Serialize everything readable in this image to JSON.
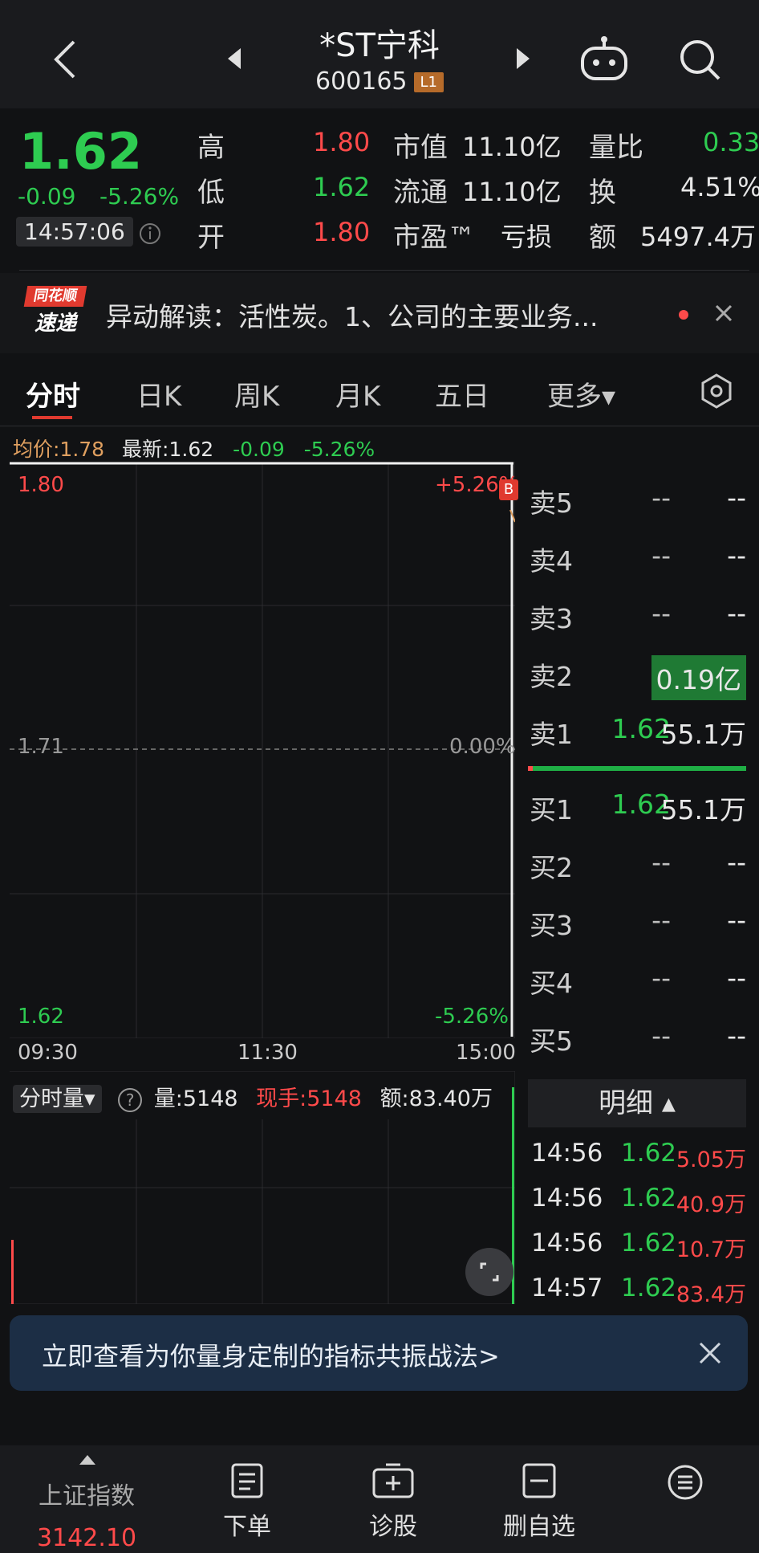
{
  "header": {
    "title": "*ST宁科",
    "code": "600165",
    "level_badge": "L1"
  },
  "quote": {
    "price": "1.62",
    "change": "-0.09",
    "change_pct": "-5.26%",
    "time": "14:57:06",
    "high_label": "高",
    "high": "1.80",
    "low_label": "低",
    "low": "1.62",
    "open_label": "开",
    "open": "1.80",
    "mcap_label": "市值",
    "mcap": "11.10亿",
    "float_label": "流通",
    "float": "11.10亿",
    "pe_label": "市盈™",
    "pe": "亏损",
    "vr_label": "量比",
    "vr": "0.33",
    "turn_label": "换",
    "turn": "4.51%",
    "amt_label": "额",
    "amt": "5497.4万"
  },
  "news": {
    "logo_top": "同花顺",
    "logo_bottom": "速递",
    "text": "异动解读：活性炭。1、公司的主要业务..."
  },
  "tabs": [
    "分时",
    "日K",
    "周K",
    "月K",
    "五日",
    "更多▾"
  ],
  "chart_info": {
    "avg_label": "均价:1.78",
    "latest_label": "最新:1.62",
    "chg": "-0.09",
    "chg_pct": "-5.26%"
  },
  "chart": {
    "y_top": "1.80",
    "y_mid": "1.71",
    "y_bottom": "1.62",
    "pct_top": "+5.26%",
    "pct_mid": "0.00%",
    "pct_bottom": "-5.26%",
    "x_start": "09:30",
    "x_mid": "11:30",
    "x_end": "15:00",
    "marker": "B"
  },
  "chart_data": {
    "type": "line",
    "x": [
      "09:30",
      "11:30",
      "15:00"
    ],
    "series": [
      {
        "values": [
          1.8,
          1.62
        ]
      }
    ],
    "ylim": [
      1.62,
      1.8
    ]
  },
  "volume_bar": {
    "label": "分时量▾",
    "help": "?",
    "vol": "量:5148",
    "hand": "现手:5148",
    "amt": "额:83.40万"
  },
  "order_book": {
    "asks": [
      {
        "label": "卖5",
        "price": "--",
        "vol": "--"
      },
      {
        "label": "卖4",
        "price": "--",
        "vol": "--"
      },
      {
        "label": "卖3",
        "price": "--",
        "vol": "--"
      },
      {
        "label": "卖2",
        "price": "--",
        "vol": "0.19亿"
      },
      {
        "label": "卖1",
        "price": "1.62",
        "vol": "55.1万"
      }
    ],
    "bids": [
      {
        "label": "买1",
        "price": "1.62",
        "vol": "55.1万"
      },
      {
        "label": "买2",
        "price": "--",
        "vol": "--"
      },
      {
        "label": "买3",
        "price": "--",
        "vol": "--"
      },
      {
        "label": "买4",
        "price": "--",
        "vol": "--"
      },
      {
        "label": "买5",
        "price": "--",
        "vol": "--"
      }
    ]
  },
  "details": {
    "title": "明细 ▴",
    "rows": [
      {
        "time": "14:56",
        "price": "1.62",
        "vol": "5.05万"
      },
      {
        "time": "14:56",
        "price": "1.62",
        "vol": "40.9万"
      },
      {
        "time": "14:56",
        "price": "1.62",
        "vol": "10.7万"
      },
      {
        "time": "14:57",
        "price": "1.62",
        "vol": "83.4万"
      }
    ]
  },
  "banner": {
    "text": "立即查看为你量身定制的指标共振战法>"
  },
  "bottom": {
    "index_name": "上证指数",
    "index_value": "3142.10",
    "order": "下单",
    "diagnose": "诊股",
    "remove_fav": "删自选"
  }
}
